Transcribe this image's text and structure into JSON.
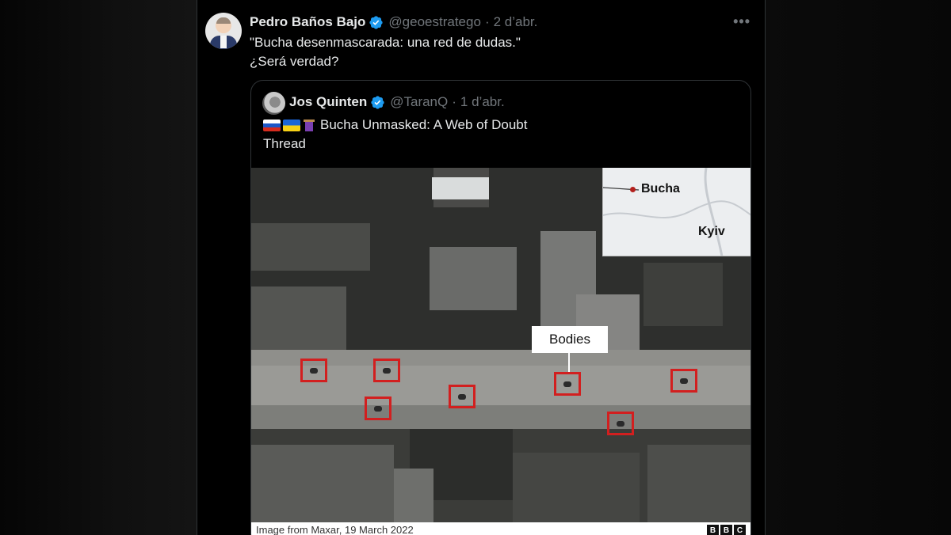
{
  "tweet": {
    "author_name": "Pedro Baños Bajo",
    "handle": "@geoestratego",
    "separator": "·",
    "time": "2 d’abr.",
    "more_icon": "more-horizontal-icon",
    "text_line1": "\"Bucha desenmascarada: una red de dudas.\"",
    "text_line2": "¿Será verdad?"
  },
  "quoted": {
    "author_name": "Jos Quinten",
    "handle": "@TaranQ",
    "separator": "·",
    "time": "1 d’abr.",
    "flags": [
      "russia-flag",
      "ukraine-flag",
      "spool-of-thread-emoji"
    ],
    "text_line1": "Bucha Unmasked: A Web of Doubt",
    "text_line2": "Thread"
  },
  "media": {
    "map_label_bucha": "Bucha",
    "map_label_kyiv": "Kyiv",
    "bodies_label": "Bodies",
    "caption": "Image from Maxar, 19 March 2022",
    "logo_letters": [
      "B",
      "B",
      "C"
    ],
    "marker_color": "#d21f1f"
  },
  "colors": {
    "verified": "#1d9bf0",
    "muted": "#71767b",
    "text": "#e7e9ea",
    "border": "#2f3336"
  }
}
